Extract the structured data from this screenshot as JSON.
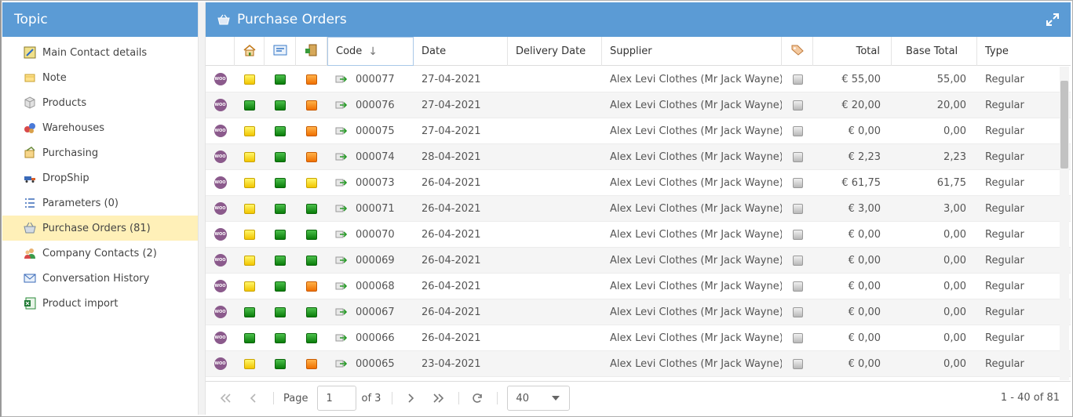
{
  "topic": {
    "title": "Topic",
    "items": [
      {
        "label": "Main Contact details",
        "icon": "contact-card-icon"
      },
      {
        "label": "Note",
        "icon": "note-icon"
      },
      {
        "label": "Products",
        "icon": "products-box-icon"
      },
      {
        "label": "Warehouses",
        "icon": "warehouses-icon"
      },
      {
        "label": "Purchasing",
        "icon": "purchasing-icon"
      },
      {
        "label": "DropShip",
        "icon": "truck-icon"
      },
      {
        "label": "Parameters (0)",
        "icon": "parameters-list-icon"
      },
      {
        "label": "Purchase Orders (81)",
        "icon": "basket-icon"
      },
      {
        "label": "Company Contacts (2)",
        "icon": "contacts-people-icon"
      },
      {
        "label": "Conversation History",
        "icon": "envelope-icon"
      },
      {
        "label": "Product import",
        "icon": "excel-icon"
      }
    ]
  },
  "main": {
    "title": "Purchase Orders",
    "columns": {
      "code": "Code",
      "date": "Date",
      "delivery_date": "Delivery Date",
      "supplier": "Supplier",
      "total": "Total",
      "base_total": "Base Total",
      "type": "Type"
    },
    "rows": [
      {
        "s1": "yellow",
        "s2": "green",
        "s3": "orange",
        "code": "000077",
        "date": "27-04-2021",
        "delivery": "",
        "supplier": "Alex Levi Clothes (Mr Jack Wayne)",
        "total": "€ 55,00",
        "base_total": "55,00",
        "type": "Regular"
      },
      {
        "s1": "green",
        "s2": "green",
        "s3": "orange",
        "code": "000076",
        "date": "27-04-2021",
        "delivery": "",
        "supplier": "Alex Levi Clothes (Mr Jack Wayne)",
        "total": "€ 20,00",
        "base_total": "20,00",
        "type": "Regular"
      },
      {
        "s1": "yellow",
        "s2": "green",
        "s3": "orange",
        "code": "000075",
        "date": "27-04-2021",
        "delivery": "",
        "supplier": "Alex Levi Clothes (Mr Jack Wayne)",
        "total": "€ 0,00",
        "base_total": "0,00",
        "type": "Regular"
      },
      {
        "s1": "yellow",
        "s2": "green",
        "s3": "orange",
        "code": "000074",
        "date": "28-04-2021",
        "delivery": "",
        "supplier": "Alex Levi Clothes (Mr Jack Wayne)",
        "total": "€ 2,23",
        "base_total": "2,23",
        "type": "Regular"
      },
      {
        "s1": "yellow",
        "s2": "green",
        "s3": "yellow",
        "code": "000073",
        "date": "26-04-2021",
        "delivery": "",
        "supplier": "Alex Levi Clothes (Mr Jack Wayne)",
        "total": "€ 61,75",
        "base_total": "61,75",
        "type": "Regular"
      },
      {
        "s1": "yellow",
        "s2": "green",
        "s3": "green",
        "code": "000071",
        "date": "26-04-2021",
        "delivery": "",
        "supplier": "Alex Levi Clothes (Mr Jack Wayne)",
        "total": "€ 3,00",
        "base_total": "3,00",
        "type": "Regular"
      },
      {
        "s1": "yellow",
        "s2": "green",
        "s3": "green",
        "code": "000070",
        "date": "26-04-2021",
        "delivery": "",
        "supplier": "Alex Levi Clothes (Mr Jack Wayne)",
        "total": "€ 0,00",
        "base_total": "0,00",
        "type": "Regular"
      },
      {
        "s1": "yellow",
        "s2": "green",
        "s3": "green",
        "code": "000069",
        "date": "26-04-2021",
        "delivery": "",
        "supplier": "Alex Levi Clothes (Mr Jack Wayne)",
        "total": "€ 0,00",
        "base_total": "0,00",
        "type": "Regular"
      },
      {
        "s1": "yellow",
        "s2": "green",
        "s3": "orange",
        "code": "000068",
        "date": "26-04-2021",
        "delivery": "",
        "supplier": "Alex Levi Clothes (Mr Jack Wayne)",
        "total": "€ 0,00",
        "base_total": "0,00",
        "type": "Regular"
      },
      {
        "s1": "green",
        "s2": "green",
        "s3": "green",
        "code": "000067",
        "date": "26-04-2021",
        "delivery": "",
        "supplier": "Alex Levi Clothes (Mr Jack Wayne)",
        "total": "€ 0,00",
        "base_total": "0,00",
        "type": "Regular"
      },
      {
        "s1": "green",
        "s2": "green",
        "s3": "green",
        "code": "000066",
        "date": "26-04-2021",
        "delivery": "",
        "supplier": "Alex Levi Clothes (Mr Jack Wayne)",
        "total": "€ 0,00",
        "base_total": "0,00",
        "type": "Regular"
      },
      {
        "s1": "yellow",
        "s2": "green",
        "s3": "orange",
        "code": "000065",
        "date": "23-04-2021",
        "delivery": "",
        "supplier": "Alex Levi Clothes (Mr Jack Wayne)",
        "total": "€ 0,00",
        "base_total": "0,00",
        "type": "Regular"
      }
    ]
  },
  "pager": {
    "page_label": "Page",
    "current_page": "1",
    "of_label": "of 3",
    "page_size": "40",
    "info": "1 - 40 of 81"
  },
  "colors": {
    "header_blue": "#5b9bd5",
    "active_topic": "#fff0b8",
    "woo_purple": "#8b5a8c"
  }
}
